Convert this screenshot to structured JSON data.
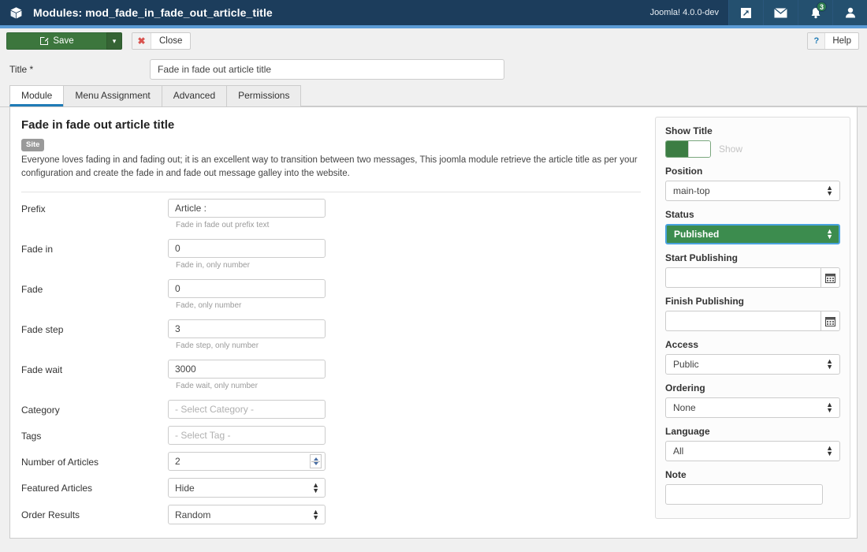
{
  "header": {
    "brand_icon": "cube-icon",
    "title": "Modules: mod_fade_in_fade_out_article_title",
    "version": "Joomla! 4.0.0-dev",
    "icons": [
      {
        "name": "preview-icon"
      },
      {
        "name": "mail-icon"
      },
      {
        "name": "bell-icon",
        "badge": "3"
      },
      {
        "name": "user-icon"
      }
    ]
  },
  "toolbar": {
    "save_label": "Save",
    "save_dropdown": "▾",
    "close_label": "Close",
    "close_icon": "x-icon",
    "help_label": "Help",
    "help_icon": "question-icon"
  },
  "title_field": {
    "label": "Title *",
    "value": "Fade in fade out article title"
  },
  "tabs": [
    {
      "label": "Module",
      "active": true
    },
    {
      "label": "Menu Assignment",
      "active": false
    },
    {
      "label": "Advanced",
      "active": false
    },
    {
      "label": "Permissions",
      "active": false
    }
  ],
  "module": {
    "heading": "Fade in fade out article title",
    "badge": "Site",
    "description": "Everyone loves fading in and fading out; it is an excellent way to transition between two messages, This joomla module retrieve the article title as per your configuration and create the fade in and fade out message galley into the website."
  },
  "fields": [
    {
      "label": "Prefix",
      "type": "text",
      "value": "Article :",
      "hint": "Fade in fade out prefix text"
    },
    {
      "label": "Fade in",
      "type": "text",
      "value": "0",
      "hint": "Fade in, only number"
    },
    {
      "label": "Fade",
      "type": "text",
      "value": "0",
      "hint": "Fade, only number"
    },
    {
      "label": "Fade step",
      "type": "text",
      "value": "3",
      "hint": "Fade step, only number"
    },
    {
      "label": "Fade wait",
      "type": "text",
      "value": "3000",
      "hint": "Fade wait, only number"
    },
    {
      "label": "Category",
      "type": "placeholder",
      "value": "",
      "placeholder": "- Select Category -",
      "hint": ""
    },
    {
      "label": "Tags",
      "type": "placeholder",
      "value": "",
      "placeholder": "- Select Tag -",
      "hint": ""
    },
    {
      "label": "Number of Articles",
      "type": "number",
      "value": "2",
      "hint": ""
    },
    {
      "label": "Featured Articles",
      "type": "select",
      "value": "Hide",
      "hint": ""
    },
    {
      "label": "Order Results",
      "type": "select",
      "value": "Random",
      "hint": ""
    }
  ],
  "sidebar": {
    "show_title": {
      "label": "Show Title",
      "state_label": "Show",
      "enabled": true
    },
    "position": {
      "label": "Position",
      "value": "main-top"
    },
    "status": {
      "label": "Status",
      "value": "Published",
      "color": "#3c8c4e"
    },
    "start_publishing": {
      "label": "Start Publishing",
      "value": "",
      "icon": "calendar-icon"
    },
    "finish_publishing": {
      "label": "Finish Publishing",
      "value": "",
      "icon": "calendar-icon"
    },
    "access": {
      "label": "Access",
      "value": "Public"
    },
    "ordering": {
      "label": "Ordering",
      "value": "None"
    },
    "language": {
      "label": "Language",
      "value": "All"
    },
    "note": {
      "label": "Note",
      "value": ""
    }
  },
  "colors": {
    "header_bg": "#1c3d5c",
    "accent_line": "#5b9bd5",
    "save_green": "#3c763d",
    "status_green": "#3c8c4e",
    "tab_active": "#1f7bb6"
  }
}
